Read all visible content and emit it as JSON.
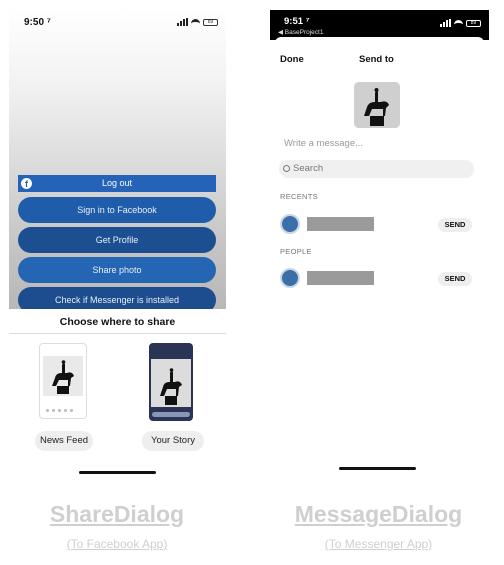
{
  "left_screen": {
    "status": {
      "time": "9:50 ⁷",
      "battery": "89"
    },
    "buttons": {
      "logout": "Log out",
      "sign_in": "Sign in to Facebook",
      "get_profile": "Get Profile",
      "share_photo": "Share photo",
      "check_installed": "Check if Messenger is installed"
    },
    "share_sheet": {
      "title": "Choose where to share",
      "options": [
        "News Feed",
        "Your Story"
      ]
    },
    "caption": {
      "title": "ShareDialog",
      "subtitle": "(To Facebook App)"
    }
  },
  "right_screen": {
    "status": {
      "time": "9:51 ⁷",
      "back_label": "◀ BaseProject1",
      "battery": "89"
    },
    "header": {
      "done": "Done",
      "title": "Send to"
    },
    "message_placeholder": "Write a message...",
    "search_placeholder": "Search",
    "sections": {
      "recents": "RECENTS",
      "people": "PEOPLE"
    },
    "send_label": "SEND",
    "caption": {
      "title": "MessageDialog",
      "subtitle": "(To Messenger App)"
    }
  },
  "colors": {
    "facebook_blue": "#1f5dab",
    "caption_gray": "#cfcfcf"
  }
}
